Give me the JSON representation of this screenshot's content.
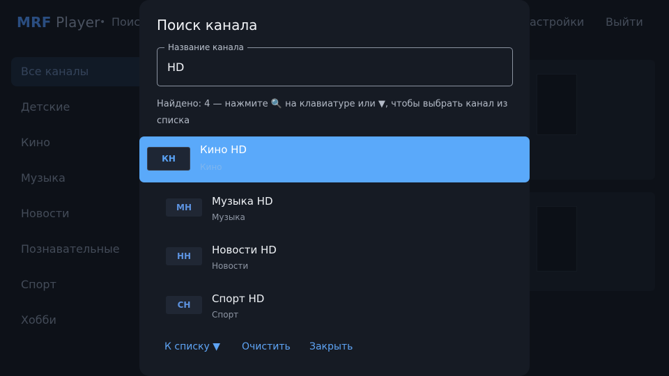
{
  "app": {
    "logo_prefix": "MRF",
    "logo_suffix": "Player",
    "nav_partial": "Поис",
    "settings_partial": "астройки",
    "logout": "Выйти"
  },
  "sidebar": {
    "items": [
      {
        "label": "Все каналы",
        "active": true
      },
      {
        "label": "Детские"
      },
      {
        "label": "Кино"
      },
      {
        "label": "Музыка"
      },
      {
        "label": "Новости"
      },
      {
        "label": "Познавательные"
      },
      {
        "label": "Спорт"
      },
      {
        "label": "Хобби"
      }
    ]
  },
  "dialog": {
    "title": "Поиск канала",
    "field_label": "Название канала",
    "query": "HD",
    "hint": "Найдено: 4 — нажмите 🔍 на клавиатуре или ▼, чтобы выбрать канал из списка",
    "results": [
      {
        "badge": "КН",
        "name": "Кино HD",
        "category": "Кино",
        "selected": true
      },
      {
        "badge": "МН",
        "name": "Музыка HD",
        "category": "Музыка"
      },
      {
        "badge": "НН",
        "name": "Новости HD",
        "category": "Новости"
      },
      {
        "badge": "СН",
        "name": "Спорт HD",
        "category": "Спорт"
      }
    ],
    "buttons": {
      "to_list": "К списку ▼",
      "clear": "Очистить",
      "close": "Закрыть"
    }
  },
  "colors": {
    "accent": "#5aa9fa",
    "dialog_bg": "#161b24",
    "app_bg": "#0d1118"
  }
}
